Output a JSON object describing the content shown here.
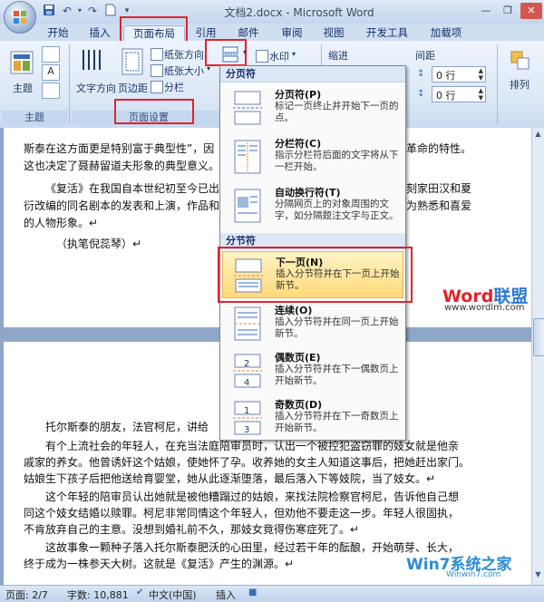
{
  "window": {
    "title": "文档2.docx - Microsoft Word"
  },
  "tabs": [
    {
      "label": "开始"
    },
    {
      "label": "插入"
    },
    {
      "label": "页面布局"
    },
    {
      "label": "引用"
    },
    {
      "label": "邮件"
    },
    {
      "label": "审阅"
    },
    {
      "label": "视图"
    },
    {
      "label": "开发工具"
    },
    {
      "label": "加载项"
    }
  ],
  "ribbon": {
    "theme_group": {
      "theme_label": "主题",
      "group_label": "主题"
    },
    "page_setup": {
      "text_direction": "文字方向",
      "margins": "页边距",
      "orientation": "纸张方向",
      "size": "纸张大小",
      "columns": "分栏",
      "group_label": "页面设置"
    },
    "background": {
      "watermark": "水印"
    },
    "paragraph": {
      "indent_label": "缩进",
      "spacing_label": "间距",
      "before_value": "0 行",
      "after_value": "0 行"
    },
    "arrange": {
      "label": "排列"
    }
  },
  "menu": {
    "page_breaks_header": "分页符",
    "section_breaks_header": "分节符",
    "items": [
      {
        "title": "分页符(P)",
        "desc": "标记一页终止并开始下一页的点。"
      },
      {
        "title": "分栏符(C)",
        "desc": "指示分栏符后面的文字将从下一栏开始。"
      },
      {
        "title": "自动换行符(T)",
        "desc": "分隔网页上的对象周围的文字，如分隔题注文字与正文。"
      },
      {
        "title": "下一页(N)",
        "desc": "插入分节符并在下一页上开始新节。"
      },
      {
        "title": "连续(O)",
        "desc": "插入分节符并在同一页上开始新节。"
      },
      {
        "title": "偶数页(E)",
        "desc": "插入分节符并在下一偶数页上开始新节。"
      },
      {
        "title": "奇数页(D)",
        "desc": "插入分节符并在下一奇数页上开始新节。"
      }
    ]
  },
  "document": {
    "page1_lines": [
      "斯泰在这方面更是特别富于典型性”，因",
      "这也决定了聂赫留道夫形象的典型意义。",
      "《复活》在我国自本世纪初至今已出",
      "衍改编的同名剧本的发表和上演，作品和",
      "的人物形象。↵",
      "（执笔倪蕊琴）↵"
    ],
    "page1_right": [
      "革命的特性。",
      "刻家田汉和夏",
      "为熟悉和喜爱"
    ],
    "page2_lines": [
      "托尔斯泰的朋友，法官柯尼，讲给",
      "有个上流社会的年轻人，在充当法庭陪审员时，认出一个被控犯盗窃罪的妓女就是他亲",
      "戚家的养女。他曾诱奸这个姑娘，使她怀了孕。收养她的女主人知道这事后，把她赶出家门。",
      "姑娘生下孩子后把他送给育婴堂，她从此逐渐堕落，最后落入下等妓院，当了妓女。↵",
      "这个年轻的陪审员认出她就是被他糟蹋过的姑娘，来找法院检察官柯尼，告诉他自己想",
      "同这个妓女结婚以赎罪。柯尼非常同情这个年轻人，但劝他不要走这一步。年轻人很固执，",
      "不肯放弃自己的主意。没想到婚礼前不久，那妓女竟得伤寒症死了。↵",
      "这故事象一颗种子落入托尔斯泰肥沃的心田里，经过若干年的酝酿，开始萌芽、长大，",
      "终于成为一株参天大树。这就是《复活》产生的渊源。↵"
    ]
  },
  "watermarks": {
    "wordlm_logo_a": "Word",
    "wordlm_logo_b": "联盟",
    "wordlm_url": "www.wordlm.com",
    "win7_logo": "Win7系统之家",
    "win7_url": "Winwin7.com"
  },
  "status": {
    "page": "页面: 2/7",
    "words": "字数: 10,881",
    "language": "中文(中国)",
    "insert_mode": "插入"
  },
  "colors": {
    "highlight_red": "#e3222a",
    "ribbon_bg": "#dbe7f6",
    "menu_highlight": "#ffd97a"
  }
}
